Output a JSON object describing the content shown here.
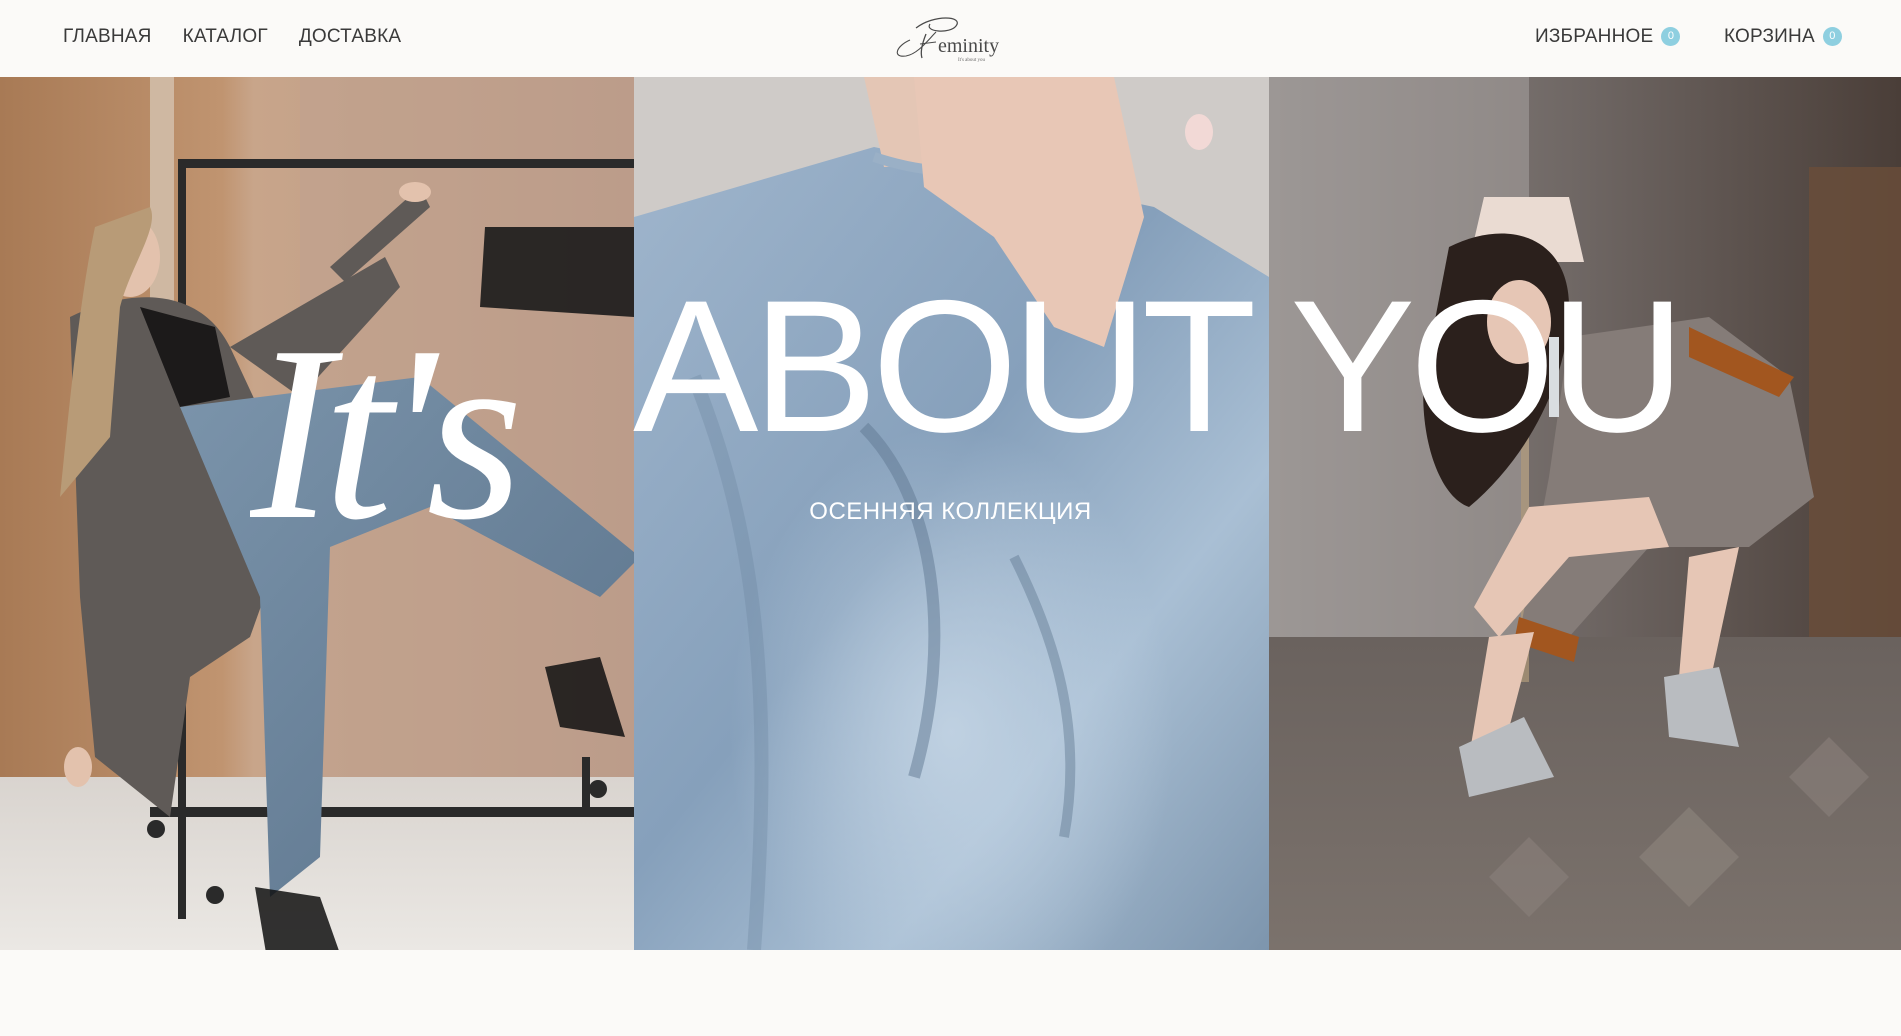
{
  "nav": {
    "home": "ГЛАВНАЯ",
    "catalog": "КАТАЛОГ",
    "delivery": "ДОСТАВКА"
  },
  "logo": {
    "name": "Feminity",
    "tagline": "It's about you"
  },
  "favorites": {
    "label": "ИЗБРАННОЕ",
    "count": "0"
  },
  "cart": {
    "label": "КОРЗИНА",
    "count": "0"
  },
  "hero": {
    "script_word": "It's",
    "headline": "ABOUT YOU",
    "subtitle": "ОСЕННЯЯ КОЛЛЕКЦИЯ"
  },
  "colors": {
    "background": "#fbfaf8",
    "nav_text": "#3a3a3a",
    "counter_badge": "#8ecfe0",
    "hero_text": "#ffffff"
  },
  "icons": [
    "feminity-logo"
  ]
}
